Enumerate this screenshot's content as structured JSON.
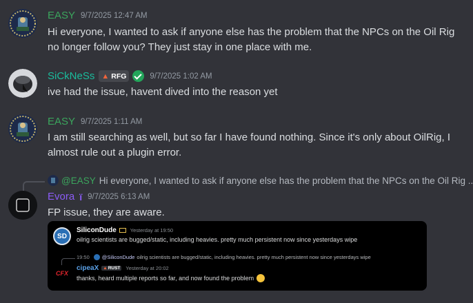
{
  "messages": [
    {
      "username": "EASY",
      "timestamp": "9/7/2025 12:47 AM",
      "lines": [
        "Hi everyone, I wanted to ask if anyone else has the problem that the NPCs on the Oil Rig",
        "no longer follow you? They just stay in one place with me."
      ]
    },
    {
      "username": "SiCkNeSs",
      "tag": "RFG",
      "timestamp": "9/7/2025 1:02 AM",
      "lines": [
        "ive had the issue, havent dived into the reason yet"
      ]
    },
    {
      "username": "EASY",
      "timestamp": "9/7/2025 1:11 AM",
      "lines": [
        "I am still searching as well, but so far I have found nothing. Since it's only about OilRig, I",
        "almost rule out a plugin error."
      ]
    },
    {
      "username": "Evora",
      "timestamp": "9/7/2025 6:13 AM",
      "lines": [
        "FP issue, they are aware."
      ],
      "reply": {
        "mention": "@EASY",
        "text": "Hi everyone, I wanted to ask if anyone else has the problem that the NPCs on the Oil Rig ..."
      }
    }
  ],
  "attachment": {
    "first": {
      "username": "SiliconDude",
      "timestamp": "Yesterday at 19:50",
      "text": "oilrig scientists are bugged/static, including heavies. pretty much persistent now since yesterdays wipe"
    },
    "reply_preview": {
      "time": "19:50",
      "mention": "@SiliconDude",
      "text": "oilrig scientists are bugged/static, including heavies. pretty much persistent now since yesterdays wipe"
    },
    "second": {
      "username": "cipeaX",
      "tag": "RUST",
      "timestamp": "Yesterday at 20:02",
      "text": "thanks, heard multiple reports so far, and now found the problem"
    },
    "avatar_labels": {
      "sd": "SD",
      "cfx": "CFX"
    }
  },
  "colors": {
    "background": "#323339",
    "easy": "#3ba55d",
    "sickness": "#1abc9c",
    "evora": "#8b5cf6",
    "mention": "#c9cdfb",
    "verified": "#23a55a",
    "timestamp": "#949ba4"
  }
}
